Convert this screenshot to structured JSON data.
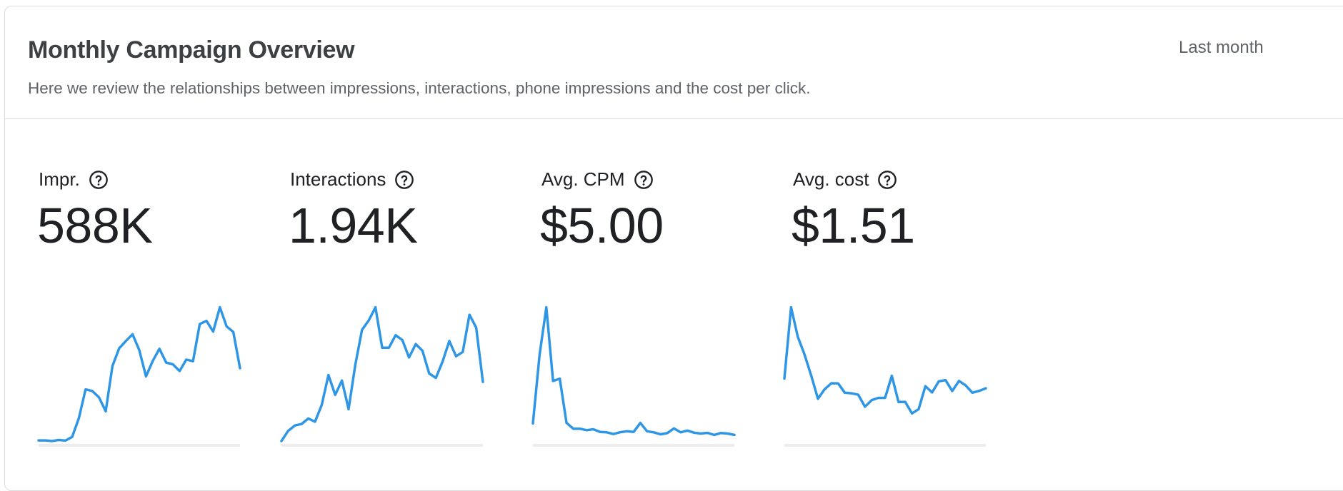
{
  "header": {
    "title": "Monthly Campaign Overview",
    "subtitle": "Here we review the relationships between impressions, interactions, phone impressions and the cost per click.",
    "date_range": "Last month"
  },
  "metrics": [
    {
      "label": "Impr.",
      "value": "588K",
      "icon": "help-circle-icon"
    },
    {
      "label": "Interactions",
      "value": "1.94K",
      "icon": "help-circle-icon"
    },
    {
      "label": "Avg. CPM",
      "value": "$5.00",
      "icon": "help-circle-icon"
    },
    {
      "label": "Avg. cost",
      "value": "$1.51",
      "icon": "help-circle-icon"
    }
  ],
  "colors": {
    "line": "#2f96e6",
    "baseline": "#ececec",
    "border": "#dadce0",
    "text_primary": "#202124",
    "text_secondary": "#5f6368"
  },
  "chart_data": [
    {
      "type": "line",
      "name": "Impr.",
      "grid": false,
      "values": [
        0.5,
        0.5,
        0,
        0.8,
        0.3,
        3.1,
        17,
        38.5,
        37.3,
        32.5,
        22.2,
        55.9,
        69.1,
        74.6,
        79.6,
        67.7,
        48.2,
        59.7,
        68.8,
        58.5,
        57.2,
        52.2,
        60.7,
        59.5,
        87.2,
        89.6,
        81.6,
        99.7,
        85.5,
        81.3,
        54.3
      ]
    },
    {
      "type": "line",
      "name": "Interactions",
      "grid": false,
      "values": [
        0,
        7.6,
        11.6,
        12.7,
        16.8,
        14.4,
        26.9,
        49.2,
        34.4,
        45.1,
        23.8,
        56.9,
        82.9,
        89.9,
        99.7,
        69.5,
        69.5,
        78.9,
        75.3,
        62.3,
        72.3,
        67.3,
        50.3,
        47.1,
        59.3,
        74.6,
        63.2,
        66.4,
        94.1,
        84.5,
        44.1
      ]
    },
    {
      "type": "line",
      "name": "Avg. CPM",
      "grid": false,
      "values": [
        13.2,
        64.6,
        99.7,
        44.8,
        46.5,
        13.6,
        9.2,
        9.2,
        8.1,
        8.8,
        6.8,
        6.5,
        5.2,
        6.6,
        7.3,
        6.8,
        13.5,
        7.3,
        6.5,
        5.0,
        5.9,
        9.4,
        6.5,
        7.8,
        6.2,
        5.6,
        6.1,
        4.6,
        6.0,
        5.6,
        4.6
      ]
    },
    {
      "type": "line",
      "name": "Avg. cost",
      "grid": false,
      "values": [
        46.6,
        99.7,
        77.7,
        64.5,
        48.7,
        31.5,
        38.6,
        43.1,
        43.0,
        36.0,
        35.6,
        34.5,
        25.6,
        30.5,
        32.2,
        32.2,
        48.6,
        29.1,
        29.2,
        20.6,
        23.8,
        40.9,
        36.2,
        44.5,
        45.4,
        37.3,
        44.8,
        41.5,
        36.0,
        37.4,
        39.3
      ]
    }
  ]
}
